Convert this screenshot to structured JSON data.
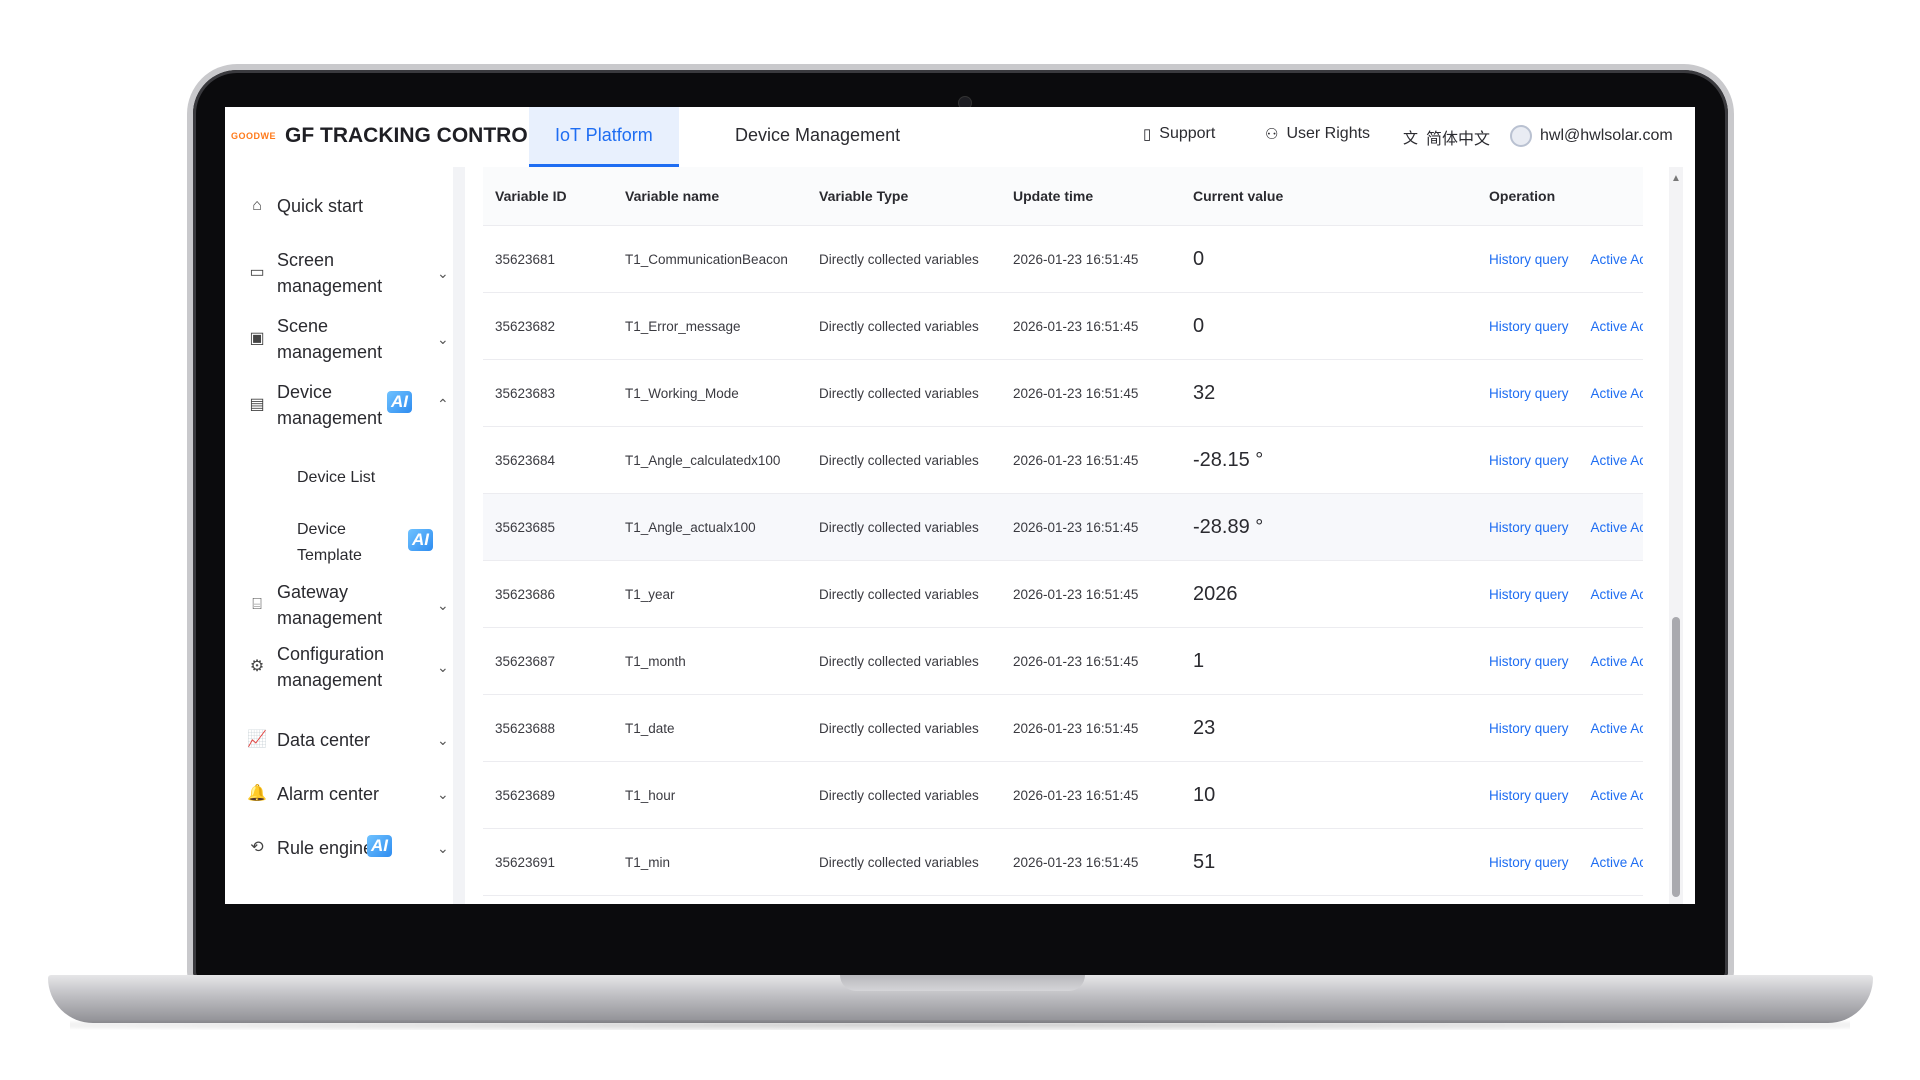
{
  "header": {
    "logo_text": "GOODWE",
    "app_title": "GF TRACKING CONTROL",
    "tabs": [
      {
        "label": "IoT Platform",
        "active": true
      },
      {
        "label": "Device Management",
        "active": false
      }
    ],
    "support_label": "Support",
    "user_rights_label": "User Rights",
    "language_label": "简体中文",
    "user_email": "hwl@hwlsolar.com"
  },
  "sidebar": {
    "items": [
      {
        "label": "Quick start",
        "icon": "home-icon"
      },
      {
        "label": "Screen management",
        "icon": "monitor-icon"
      },
      {
        "label": "Scene management",
        "icon": "layout-icon"
      },
      {
        "label": "Device management",
        "icon": "device-icon",
        "badge": "AI"
      },
      {
        "label": "Device List"
      },
      {
        "label": "Device Template",
        "badge": "AI"
      },
      {
        "label": "Gateway management",
        "icon": "router-icon"
      },
      {
        "label": "Configuration management",
        "icon": "config-icon"
      },
      {
        "label": "Data center",
        "icon": "chart-icon"
      },
      {
        "label": "Alarm center",
        "icon": "bell-icon"
      },
      {
        "label": "Rule engine",
        "icon": "rule-icon",
        "badge": "AI"
      }
    ]
  },
  "table": {
    "columns": [
      "Variable ID",
      "Variable name",
      "Variable Type",
      "Update time",
      "Current value",
      "Operation"
    ],
    "op_history": "History query",
    "op_active": "Active Acq",
    "rows": [
      {
        "id": "35623681",
        "name": "T1_CommunicationBeacon",
        "type": "Directly collected variables",
        "time": "2026-01-23 16:51:45",
        "value": "0"
      },
      {
        "id": "35623682",
        "name": "T1_Error_message",
        "type": "Directly collected variables",
        "time": "2026-01-23 16:51:45",
        "value": "0"
      },
      {
        "id": "35623683",
        "name": "T1_Working_Mode",
        "type": "Directly collected variables",
        "time": "2026-01-23 16:51:45",
        "value": "32"
      },
      {
        "id": "35623684",
        "name": "T1_Angle_calculatedx100",
        "type": "Directly collected variables",
        "time": "2026-01-23 16:51:45",
        "value": "-28.15 °"
      },
      {
        "id": "35623685",
        "name": "T1_Angle_actualx100",
        "type": "Directly collected variables",
        "time": "2026-01-23 16:51:45",
        "value": "-28.89 °"
      },
      {
        "id": "35623686",
        "name": "T1_year",
        "type": "Directly collected variables",
        "time": "2026-01-23 16:51:45",
        "value": "2026"
      },
      {
        "id": "35623687",
        "name": "T1_month",
        "type": "Directly collected variables",
        "time": "2026-01-23 16:51:45",
        "value": "1"
      },
      {
        "id": "35623688",
        "name": "T1_date",
        "type": "Directly collected variables",
        "time": "2026-01-23 16:51:45",
        "value": "23"
      },
      {
        "id": "35623689",
        "name": "T1_hour",
        "type": "Directly collected variables",
        "time": "2026-01-23 16:51:45",
        "value": "10"
      },
      {
        "id": "35623691",
        "name": "T1_min",
        "type": "Directly collected variables",
        "time": "2026-01-23 16:51:45",
        "value": "51"
      }
    ]
  },
  "colors": {
    "accent": "#1e6df2",
    "logo": "#ff7a1a",
    "frame": "#0b0b0d"
  }
}
